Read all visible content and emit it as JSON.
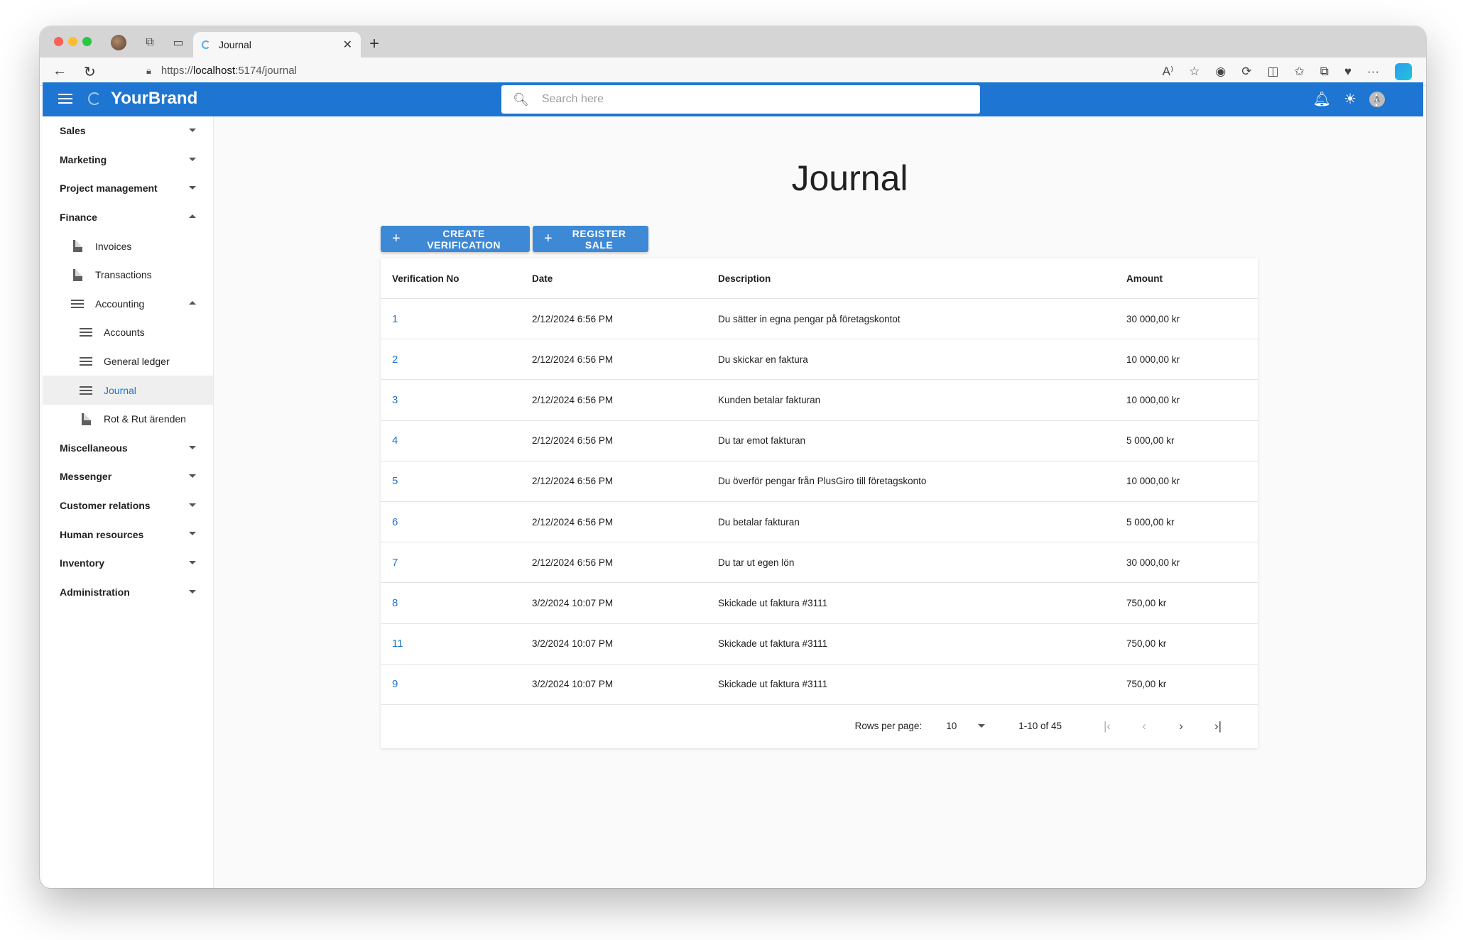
{
  "browser": {
    "tab_title": "Journal",
    "url_scheme": "https://",
    "url_host": "localhost",
    "url_rest": ":5174/journal"
  },
  "app": {
    "brand": "YourBrand",
    "search_placeholder": "Search here",
    "user_initial": "A"
  },
  "sidebar": {
    "sales": "Sales",
    "marketing": "Marketing",
    "project_management": "Project management",
    "finance": "Finance",
    "invoices": "Invoices",
    "transactions": "Transactions",
    "accounting": "Accounting",
    "accounts": "Accounts",
    "general_ledger": "General ledger",
    "journal": "Journal",
    "rot_rut": "Rot & Rut ärenden",
    "miscellaneous": "Miscellaneous",
    "messenger": "Messenger",
    "customer_relations": "Customer relations",
    "human_resources": "Human resources",
    "inventory": "Inventory",
    "administration": "Administration"
  },
  "page": {
    "title": "Journal",
    "create_button": "CREATE VERIFICATION",
    "register_button": "REGISTER SALE"
  },
  "table": {
    "headers": [
      "Verification No",
      "Date",
      "Description",
      "Amount"
    ],
    "rows": [
      {
        "no": "1",
        "date": "2/12/2024 6:56 PM",
        "desc": "Du sätter in egna pengar på företagskontot",
        "amount": "30 000,00 kr"
      },
      {
        "no": "2",
        "date": "2/12/2024 6:56 PM",
        "desc": "Du skickar en faktura",
        "amount": "10 000,00 kr"
      },
      {
        "no": "3",
        "date": "2/12/2024 6:56 PM",
        "desc": "Kunden betalar fakturan",
        "amount": "10 000,00 kr"
      },
      {
        "no": "4",
        "date": "2/12/2024 6:56 PM",
        "desc": "Du tar emot fakturan",
        "amount": "5 000,00 kr"
      },
      {
        "no": "5",
        "date": "2/12/2024 6:56 PM",
        "desc": "Du överför pengar från PlusGiro till företagskonto",
        "amount": "10 000,00 kr"
      },
      {
        "no": "6",
        "date": "2/12/2024 6:56 PM",
        "desc": "Du betalar fakturan",
        "amount": "5 000,00 kr"
      },
      {
        "no": "7",
        "date": "2/12/2024 6:56 PM",
        "desc": "Du tar ut egen lön",
        "amount": "30 000,00 kr"
      },
      {
        "no": "8",
        "date": "3/2/2024 10:07 PM",
        "desc": "Skickade ut faktura #3111",
        "amount": "750,00 kr"
      },
      {
        "no": "11",
        "date": "3/2/2024 10:07 PM",
        "desc": "Skickade ut faktura #3111",
        "amount": "750,00 kr"
      },
      {
        "no": "9",
        "date": "3/2/2024 10:07 PM",
        "desc": "Skickade ut faktura #3111",
        "amount": "750,00 kr"
      }
    ]
  },
  "pager": {
    "rows_per_page_label": "Rows per page:",
    "rows_per_page_value": "10",
    "range": "1-10 of 45"
  },
  "colors": {
    "primary": "#1e76d2",
    "button": "#3d89d6"
  }
}
